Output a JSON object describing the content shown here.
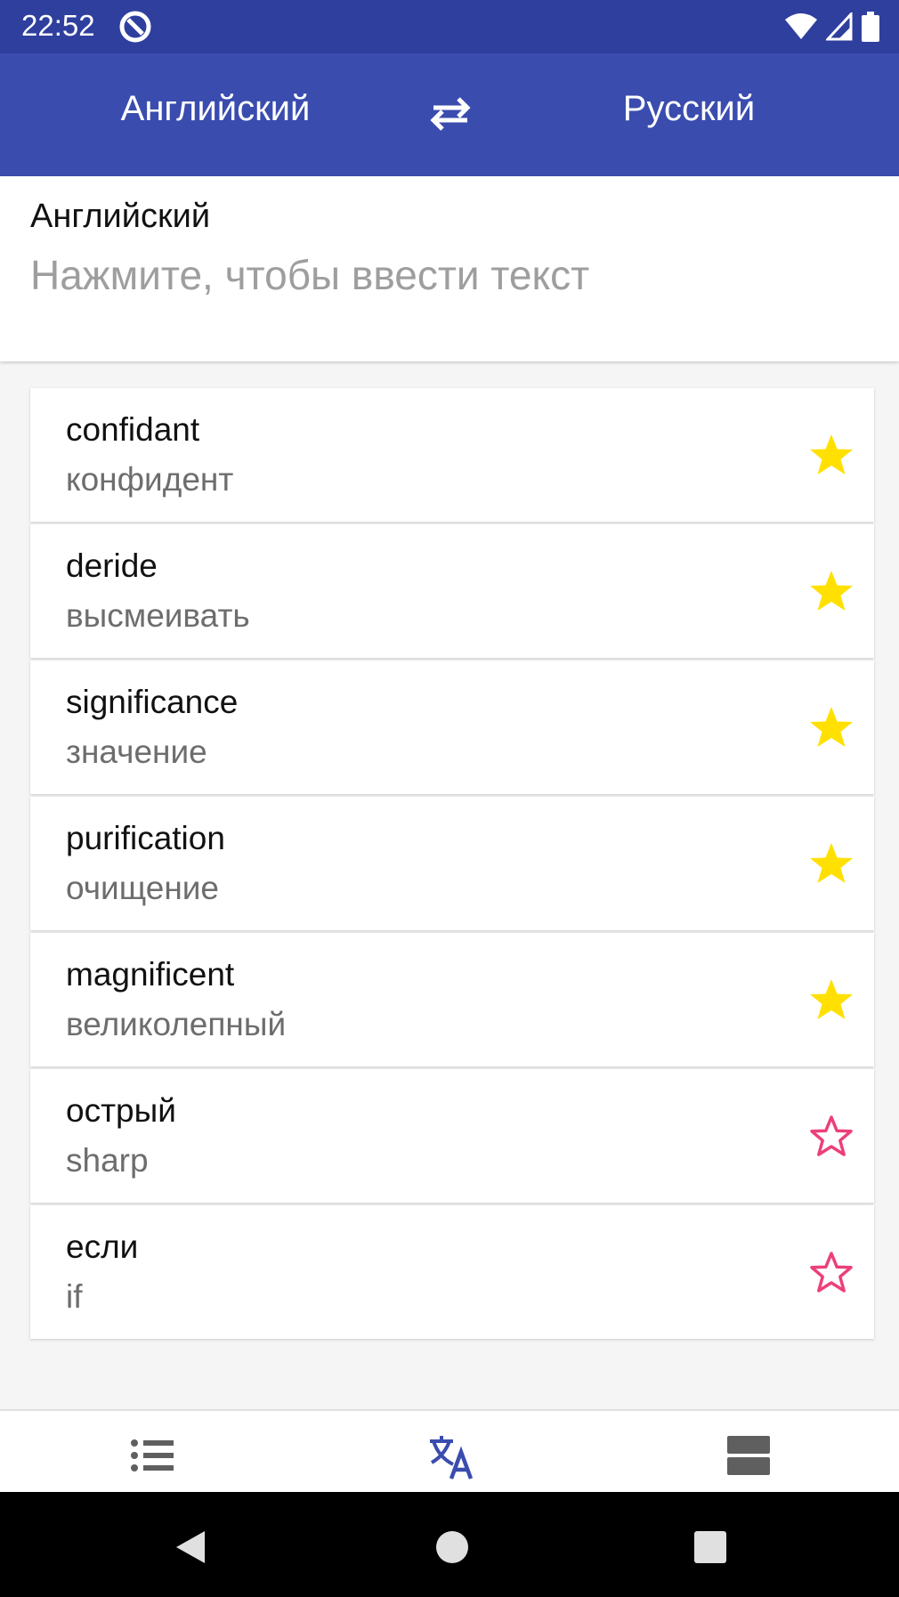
{
  "status_bar": {
    "time": "22:52",
    "icons": [
      "app-notification-icon",
      "wifi-icon",
      "signal-icon",
      "battery-icon"
    ]
  },
  "toolbar": {
    "source_language": "Английский",
    "target_language": "Русский",
    "swap_icon": "swap-arrows-icon"
  },
  "input": {
    "language_label": "Английский",
    "placeholder": "Нажмите, чтобы ввести текст"
  },
  "history": [
    {
      "word": "confidant",
      "translation": "конфидент",
      "favorite": true
    },
    {
      "word": "deride",
      "translation": "высмеивать",
      "favorite": true
    },
    {
      "word": "significance",
      "translation": "значение",
      "favorite": true
    },
    {
      "word": "purification",
      "translation": "очищение",
      "favorite": true
    },
    {
      "word": "magnificent",
      "translation": "великолепный",
      "favorite": true
    },
    {
      "word": "острый",
      "translation": "sharp",
      "favorite": false
    },
    {
      "word": "если",
      "translation": "if",
      "favorite": false
    }
  ],
  "bottom_nav": {
    "items": [
      {
        "icon": "list-icon",
        "active": false
      },
      {
        "icon": "translate-icon",
        "active": true
      },
      {
        "icon": "settings-panel-icon",
        "active": false
      }
    ]
  },
  "colors": {
    "status_bar": "#2f3f9e",
    "toolbar": "#3a4cae",
    "star_filled": "#ffe000",
    "star_outline": "#ec407a",
    "nav_active": "#3a4cae",
    "nav_inactive": "#5f5f5f"
  }
}
